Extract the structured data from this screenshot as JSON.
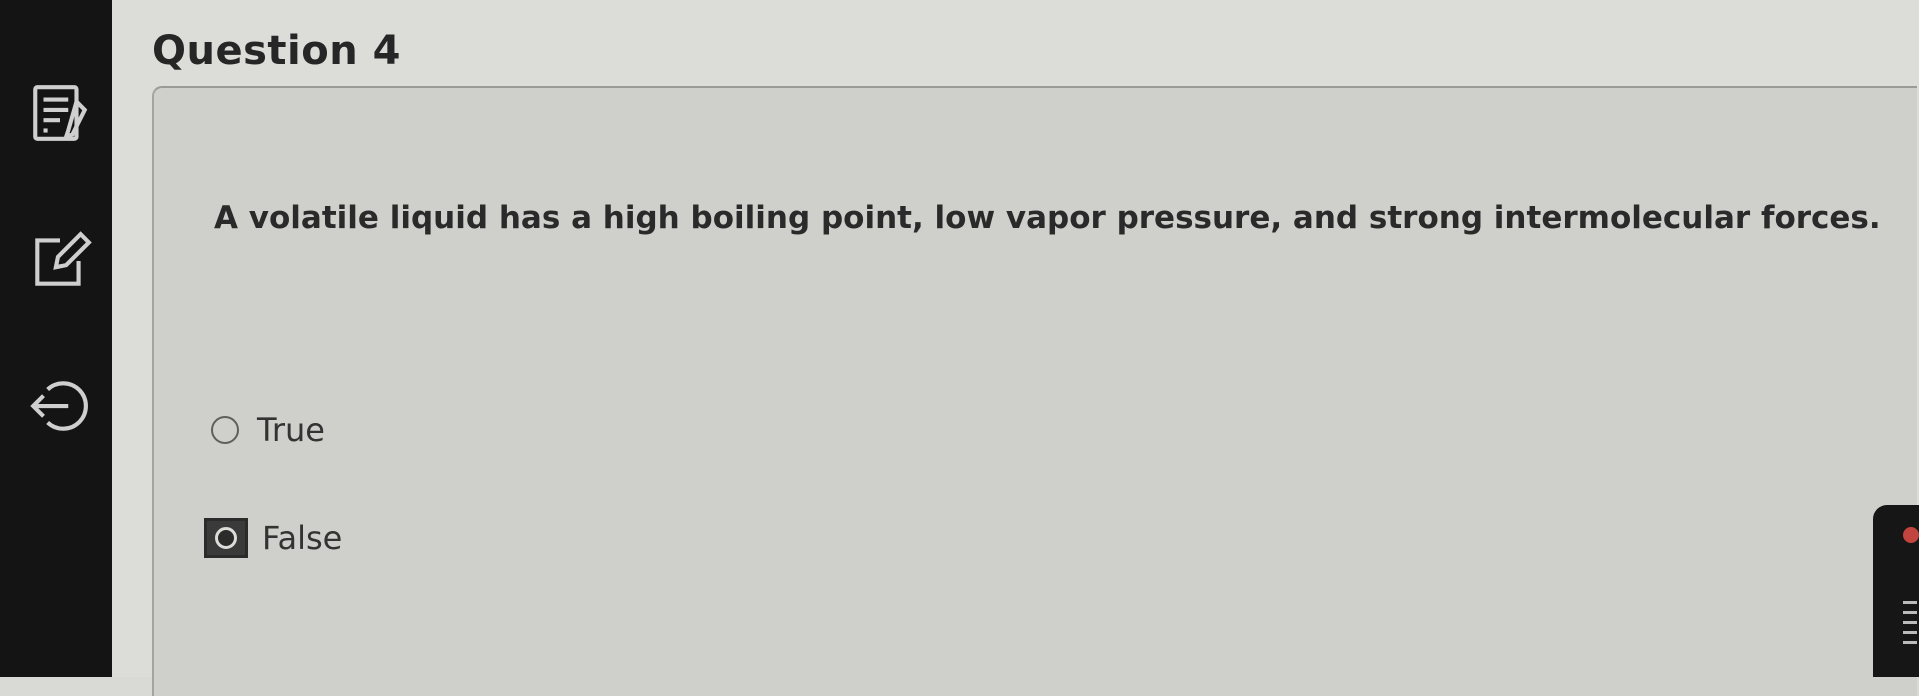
{
  "sidebar": {
    "icons": [
      "notes-icon",
      "edit-icon",
      "exit-icon"
    ]
  },
  "question": {
    "title": "Question 4",
    "text": "A volatile liquid has a high boiling point, low vapor pressure, and strong intermolecular forces.",
    "options": [
      {
        "label": "True",
        "selected": false
      },
      {
        "label": "False",
        "selected": true
      }
    ]
  },
  "colors": {
    "sidebar_bg": "#141414",
    "page_bg": "#dcdcd9",
    "card_bg": "#cfcfcc",
    "text": "#2b2b2b"
  }
}
